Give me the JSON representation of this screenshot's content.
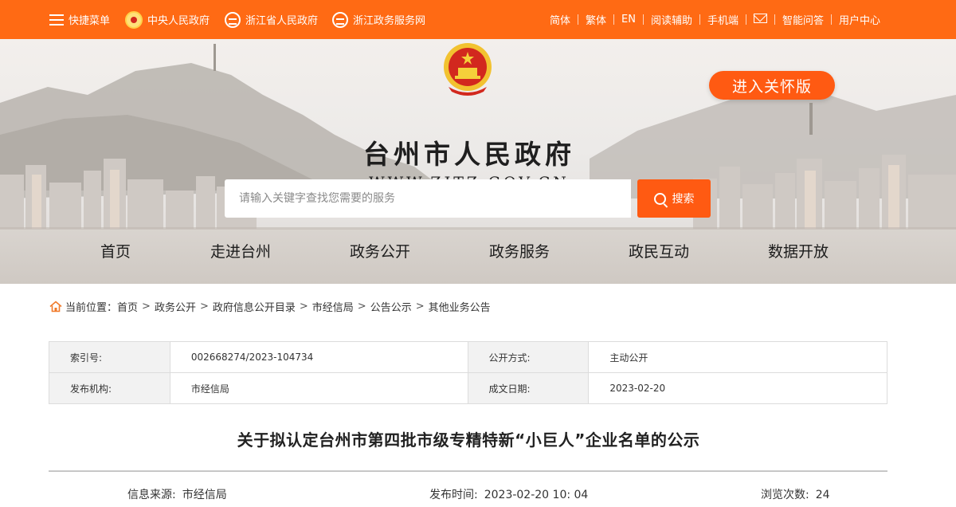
{
  "topbar": {
    "quick_menu": "快捷菜单",
    "gov_central": "中央人民政府",
    "gov_province": "浙江省人民政府",
    "gov_service": "浙江政务服务网",
    "links": [
      "简体",
      "繁体",
      "EN",
      "阅读辅助",
      "手机端",
      "智能问答",
      "用户中心"
    ],
    "mail_icon": "mail-icon"
  },
  "banner": {
    "site_title": "台州市人民政府",
    "site_url": "WWW.ZJTZ.GOV.CN",
    "care_button": "进入关怀版",
    "search_placeholder": "请输入关键字查找您需要的服务",
    "search_button": "搜索"
  },
  "nav": [
    "首页",
    "走进台州",
    "政务公开",
    "政务服务",
    "政民互动",
    "数据开放"
  ],
  "breadcrumb": {
    "label": "当前位置：",
    "items": [
      "首页",
      "政务公开",
      "政府信息公开目录",
      "市经信局",
      "公告公示",
      "其他业务公告"
    ]
  },
  "info_table": {
    "rows": [
      {
        "k1": "索引号:",
        "v1": "002668274/2023-104734",
        "k2": "公开方式:",
        "v2": "主动公开"
      },
      {
        "k1": "发布机构:",
        "v1": "市经信局",
        "k2": "成文日期:",
        "v2": "2023-02-20"
      }
    ]
  },
  "article": {
    "title": "关于拟认定台州市第四批市级专精特新“小巨人”企业名单的公示",
    "source_label": "信息来源:",
    "source": "市经信局",
    "time_label": "发布时间:",
    "time": "2023-02-20 10: 04",
    "views_label": "浏览次数:",
    "views": "24"
  },
  "colors": {
    "brand_orange": "#ff6a14",
    "button_orange": "#ff5a12",
    "table_header_bg": "#f2f2f2"
  }
}
